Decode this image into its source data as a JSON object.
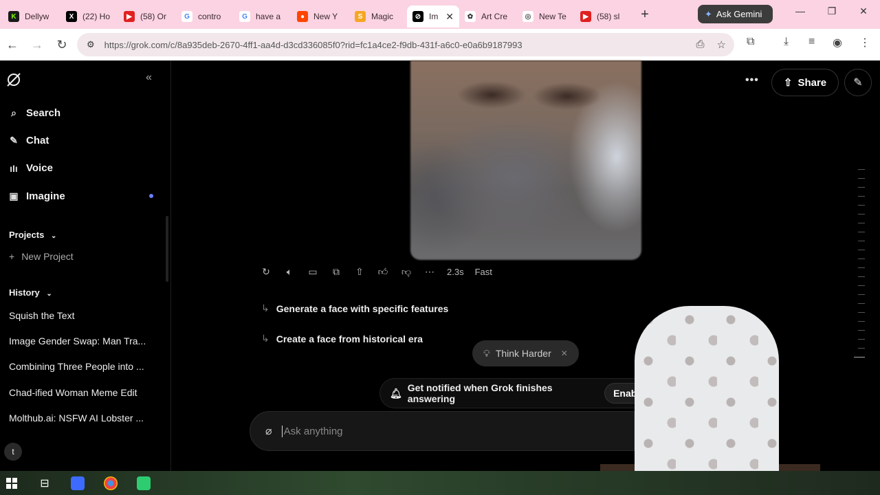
{
  "browser": {
    "tabs": [
      {
        "title": "Dellyw",
        "icon": "k-icon"
      },
      {
        "title": "(22) Ho",
        "icon": "x-icon"
      },
      {
        "title": "(58) Or",
        "icon": "youtube-icon"
      },
      {
        "title": "contro",
        "icon": "google-icon"
      },
      {
        "title": "have a",
        "icon": "google-icon"
      },
      {
        "title": "New Y",
        "icon": "reddit-icon"
      },
      {
        "title": "Magic",
        "icon": "s-icon"
      },
      {
        "title": "Im",
        "icon": "grok-icon",
        "active": true
      },
      {
        "title": "Art Cre",
        "icon": "openai-icon"
      },
      {
        "title": "New Te",
        "icon": "chrome-icon"
      },
      {
        "title": "(58) sl",
        "icon": "youtube-icon"
      }
    ],
    "ask_gemini": "Ask Gemini",
    "url": "https://grok.com/c/8a935deb-2670-4ff1-aa4d-d3cd336085f0?rid=fc1a4ce2-f9db-431f-a6c0-e0a6b9187993"
  },
  "sidebar": {
    "nav": [
      {
        "label": "Search",
        "icon": "search-icon"
      },
      {
        "label": "Chat",
        "icon": "chat-icon"
      },
      {
        "label": "Voice",
        "icon": "voice-icon"
      },
      {
        "label": "Imagine",
        "icon": "imagine-icon"
      }
    ],
    "projects_label": "Projects",
    "new_project": "New Project",
    "history_label": "History",
    "history": [
      "Squish the Text",
      "Image Gender Swap: Man Tra...",
      "Combining Three People into ...",
      "Chad-ified Woman Meme Edit",
      "Molthub.ai: NSFW AI Lobster ..."
    ],
    "avatar_letter": "t"
  },
  "main": {
    "response_time": "2.3s",
    "mode": "Fast",
    "suggestions": [
      "Generate a face with specific features",
      "Create a face from historical era"
    ],
    "think_harder": "Think Harder",
    "notify_text": "Get notified when Grok finishes answering",
    "enable_label": "Enable",
    "ask_placeholder": "Ask anything",
    "share_label": "Share"
  },
  "colors": {
    "tabbar": "#fbd3e2",
    "accent_dot": "#6b7fff"
  }
}
